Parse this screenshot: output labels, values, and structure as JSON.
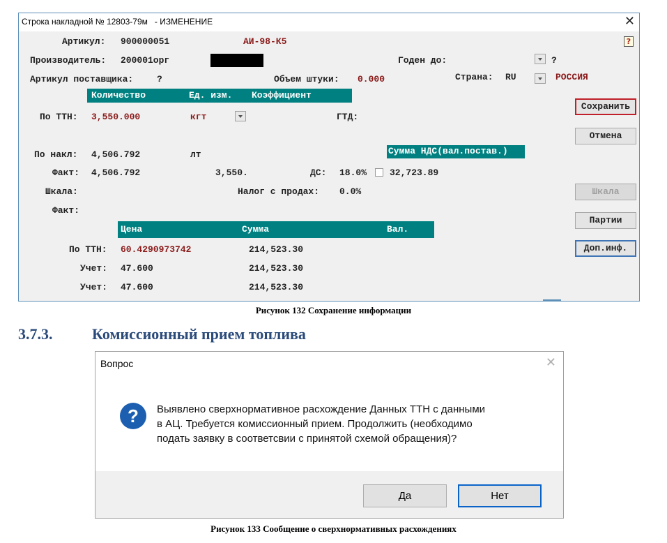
{
  "fig132": {
    "window_title": "Строка накладной № 12803-79м   - ИЗМЕНЕНИЕ",
    "close_glyph": "✕",
    "help_glyph": "?",
    "artikul_label": "Артикул:",
    "artikul_value": "900000051",
    "artikul_name": "АИ-98-К5",
    "producer_label": "Производитель:",
    "producer_value": "200001орг",
    "valid_label": "Годен до:",
    "valid_q": "?",
    "supplier_art_label": "Артикул поставщика:",
    "supplier_art_value": "?",
    "volume_label": "Объем штуки:",
    "volume_value": "0.000",
    "country_label": "Страна:",
    "country_code": "RU",
    "country_name": "РОССИЯ",
    "hdr1": {
      "qty": "Количество",
      "unit": "Ед. изм.",
      "coef": "Коэффициент"
    },
    "ttn_label": "По ТТН:",
    "ttn_qty": "3,550.000",
    "ttn_unit": "кгт",
    "gtd_label": "ГТД:",
    "nakl_label": "По накл:",
    "nakl_value": "4,506.792",
    "nakl_unit": "лт",
    "vat_header": "Сумма НДС(вал.постав.)",
    "fakt_label": "Факт:",
    "fakt_value": "4,506.792",
    "fakt_value2": "3,550.",
    "ds_label": "ДС:",
    "ds_value": "18.0%",
    "vat_value": "32,723.89",
    "scale_label": "Шкала:",
    "sales_tax_label": "Налог с продах:",
    "sales_tax_value": "0.0%",
    "fakt2_label": "Факт:",
    "hdr2": {
      "price": "Цена",
      "sum": "Сумма",
      "cur": "Вал."
    },
    "rows": [
      {
        "label": "По ТТН:",
        "price": "60.4290973742",
        "sum": "214,523.30"
      },
      {
        "label": "Учет:",
        "price": "47.600",
        "sum": "214,523.30"
      },
      {
        "label": "Учет:",
        "price": "47.600",
        "sum": "214,523.30"
      }
    ],
    "buttons": {
      "save": "Сохранить",
      "cancel": "Отмена",
      "scale": "Шкала",
      "parties": "Партии",
      "info": "Доп.инф."
    },
    "caption": "Рисунок 132 Сохранение информации"
  },
  "section": {
    "number": "3.7.3.",
    "title": "Комиссионный прием топлива"
  },
  "fig133": {
    "title": "Вопрос",
    "close_glyph": "✕",
    "icon_glyph": "?",
    "message_lines": [
      "Выявлено сверхнормативное расхождение Данных ТТН с данными",
      "в АЦ. Требуется комиссионный прием. Продолжить (необходимо",
      "подать заявку в соответсвии с принятой схемой обращения)?"
    ],
    "yes": "Да",
    "no": "Нет",
    "caption": "Рисунок 133 Сообщение о сверхнормативных расхождениях"
  }
}
